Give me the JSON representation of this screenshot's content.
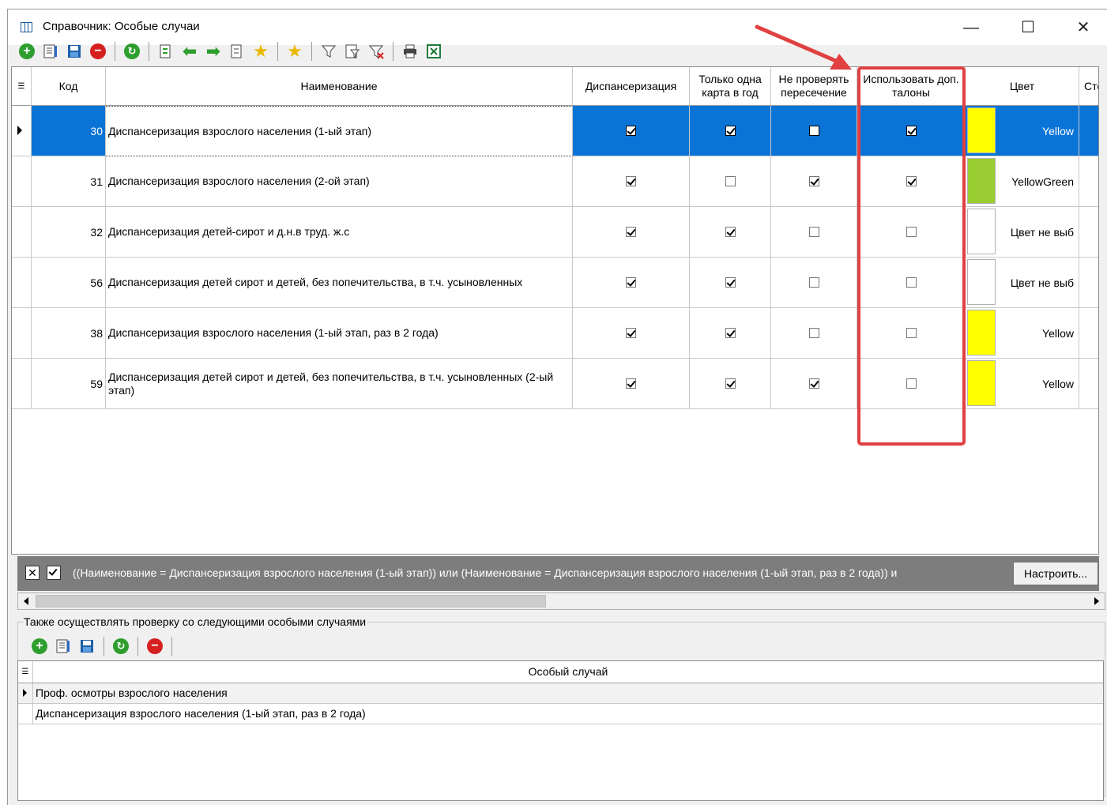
{
  "window": {
    "title": "Справочник: Особые случаи",
    "minimize": "—",
    "maximize": "☐",
    "close": "✕"
  },
  "toolbar": {
    "icons": [
      "add-icon",
      "edit-icon",
      "save-icon",
      "delete-icon",
      "refresh-icon",
      "move-icon",
      "arrow-left-icon",
      "arrow-right-icon",
      "copy-icon",
      "favorite-add-icon",
      "favorite-icon",
      "filter-icon",
      "filter-edit-icon",
      "filter-clear-icon",
      "print-icon",
      "excel-icon"
    ]
  },
  "grid": {
    "columns": {
      "code": "Код",
      "name": "Наименование",
      "dispensary": "Диспансеризация",
      "once_per_year": "Только одна карта в год",
      "no_overlap_check": "Не проверять пересечение",
      "use_extra_coupons": "Использовать доп. талоны",
      "color": "Цвет",
      "cost": "Сто"
    },
    "rows": [
      {
        "code": "30",
        "name": "Диспансеризация взрослого населения (1-ый этап)",
        "dispensary": true,
        "once_per_year": true,
        "no_overlap_check": false,
        "use_extra_coupons": true,
        "color_name": "Yellow",
        "swatch": "#ffff00",
        "selected": true
      },
      {
        "code": "31",
        "name": "Диспансеризация взрослого населения (2-ой этап)",
        "dispensary": true,
        "once_per_year": false,
        "no_overlap_check": true,
        "use_extra_coupons": true,
        "color_name": "YellowGreen",
        "swatch": "#9acd32",
        "selected": false
      },
      {
        "code": "32",
        "name": "Диспансеризация детей-сирот и д.н.в труд. ж.с",
        "dispensary": true,
        "once_per_year": true,
        "no_overlap_check": false,
        "use_extra_coupons": false,
        "color_name": "Цвет не выб",
        "swatch": "#ffffff",
        "selected": false
      },
      {
        "code": "56",
        "name": "Диспансеризация детей сирот и детей, без попечительства, в т.ч. усыновленных",
        "dispensary": true,
        "once_per_year": true,
        "no_overlap_check": false,
        "use_extra_coupons": false,
        "color_name": "Цвет не выб",
        "swatch": "#ffffff",
        "selected": false
      },
      {
        "code": "38",
        "name": "Диспансеризация взрослого населения (1-ый этап, раз в 2 года)",
        "dispensary": true,
        "once_per_year": true,
        "no_overlap_check": false,
        "use_extra_coupons": false,
        "color_name": "Yellow",
        "swatch": "#ffff00",
        "selected": false
      },
      {
        "code": "59",
        "name": "Диспансеризация детей сирот и детей, без попечительства, в т.ч. усыновленных (2-ый этап)",
        "dispensary": true,
        "once_per_year": true,
        "no_overlap_check": true,
        "use_extra_coupons": false,
        "color_name": "Yellow",
        "swatch": "#ffff00",
        "selected": false
      }
    ]
  },
  "filter": {
    "text": "((Наименование = Диспансеризация взрослого населения (1-ый этап)) или (Наименование = Диспансеризация взрослого населения (1-ый этап, раз в 2 года)) и",
    "close_symbol": "✕",
    "setup_button": "Настроить..."
  },
  "subsection": {
    "label": "Также осуществлять проверку со следующими особыми случаями",
    "column": "Особый случай",
    "rows": [
      "Проф. осмотры взрослого населения",
      "Диспансеризация взрослого населения (1-ый этап, раз в 2 года)"
    ]
  },
  "colors": {
    "selection": "#0a74d6",
    "highlight": "#e04040",
    "filter_bar": "#7d7d7d"
  }
}
